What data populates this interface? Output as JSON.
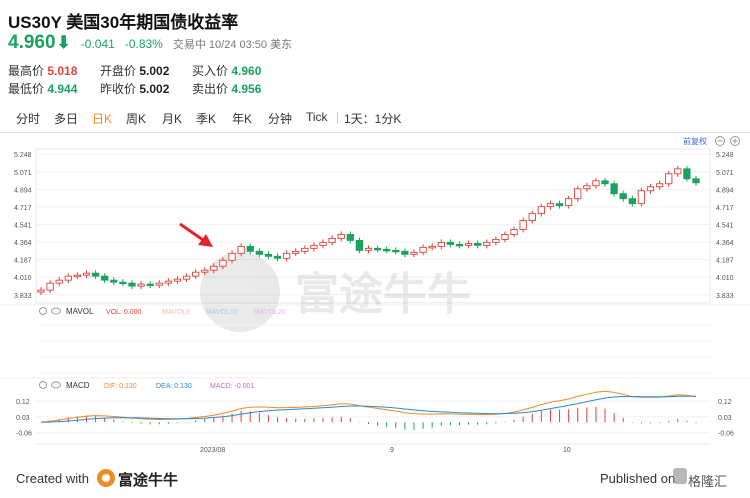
{
  "header": {
    "title": "US30Y 美国30年期国债收益率",
    "price": "4.960",
    "change": "-0.041",
    "change_pct": "-0.83%",
    "status": "交易中 10/24 03:50 美东"
  },
  "stats": [
    {
      "label": "最高价",
      "value": "5.018",
      "tone": "red"
    },
    {
      "label": "开盘价",
      "value": "5.002",
      "tone": "blk"
    },
    {
      "label": "买入价",
      "value": "4.960",
      "tone": "grn"
    },
    {
      "label": "最低价",
      "value": "4.944",
      "tone": "grn"
    },
    {
      "label": "昨收价",
      "value": "5.002",
      "tone": "blk"
    },
    {
      "label": "卖出价",
      "value": "4.956",
      "tone": "grn"
    }
  ],
  "tabs": [
    "分时",
    "多日",
    "日K",
    "周K",
    "月K",
    "季K",
    "年K",
    "分钟",
    "Tick",
    "1天：1分K"
  ],
  "active_tab": "日K",
  "chart": {
    "adjust_label": "前复权",
    "y_ticks": [
      "5.248",
      "5.071",
      "4.894",
      "4.717",
      "4.541",
      "4.364",
      "4.187",
      "4.010",
      "3.833"
    ],
    "x_labels": [
      "2023/08",
      "9",
      "10"
    ],
    "vol_bar": {
      "name": "MAVOL",
      "vol": "VOL: 0.000",
      "ma5": "MAVOL5",
      "ma10": "MAVOL10",
      "ma20": "MAVOL20"
    },
    "macd_bar": {
      "name": "MACD",
      "dif": "DIF: 0.130",
      "dea": "DEA: 0.130",
      "macd": "MACD: -0.001"
    },
    "macd_ticks": [
      "0.12",
      "0.03",
      "-0.06"
    ],
    "watermark": "富途牛牛"
  },
  "chart_data": {
    "type": "candlestick",
    "y_range": [
      3.75,
      5.3
    ],
    "ohlc_note": "approximate daily closes read from chart",
    "closes": [
      3.88,
      3.95,
      3.98,
      4.02,
      4.03,
      4.05,
      4.02,
      3.98,
      3.96,
      3.95,
      3.92,
      3.94,
      3.93,
      3.95,
      3.97,
      3.99,
      4.02,
      4.06,
      4.08,
      4.12,
      4.18,
      4.25,
      4.32,
      4.27,
      4.24,
      4.22,
      4.2,
      4.25,
      4.27,
      4.3,
      4.33,
      4.36,
      4.4,
      4.44,
      4.38,
      4.28,
      4.3,
      4.29,
      4.28,
      4.27,
      4.24,
      4.26,
      4.31,
      4.32,
      4.36,
      4.34,
      4.33,
      4.35,
      4.33,
      4.36,
      4.39,
      4.44,
      4.49,
      4.58,
      4.65,
      4.72,
      4.75,
      4.73,
      4.8,
      4.9,
      4.93,
      4.98,
      4.95,
      4.85,
      4.8,
      4.75,
      4.88,
      4.92,
      4.95,
      5.05,
      5.1,
      5.0,
      4.96
    ],
    "macd": {
      "dif": 0.13,
      "dea": 0.13,
      "hist": -0.001
    }
  },
  "footer": {
    "created": "Created with",
    "brand": "富途牛牛",
    "published": "Published on",
    "watermark": "格隆汇"
  },
  "colors": {
    "up": "#e0423a",
    "down": "#1aa260",
    "accent": "#f08a24"
  }
}
